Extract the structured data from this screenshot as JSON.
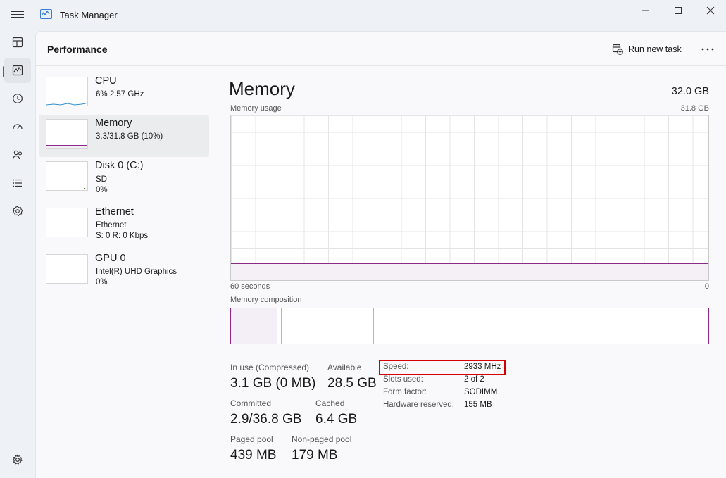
{
  "window": {
    "title": "Task Manager",
    "accent": "#1f6fd1",
    "memory_color": "#8b2a8a"
  },
  "rail": {
    "items": [
      {
        "icon": "processes-icon"
      },
      {
        "icon": "performance-icon"
      },
      {
        "icon": "app-history-icon"
      },
      {
        "icon": "startup-apps-icon"
      },
      {
        "icon": "users-icon"
      },
      {
        "icon": "details-icon"
      },
      {
        "icon": "services-icon"
      }
    ],
    "settings_icon": "settings-icon"
  },
  "header": {
    "page_title": "Performance",
    "run_new_task": "Run new task",
    "more_icon": "more-options-icon"
  },
  "resources": [
    {
      "name": "CPU",
      "line1": "6%  2.57 GHz",
      "line2": ""
    },
    {
      "name": "Memory",
      "line1": "3.3/31.8 GB (10%)",
      "line2": ""
    },
    {
      "name": "Disk 0 (C:)",
      "line1": "SD",
      "line2": "0%"
    },
    {
      "name": "Ethernet",
      "line1": "Ethernet",
      "line2": "S: 0 R: 0 Kbps"
    },
    {
      "name": "GPU 0",
      "line1": "Intel(R) UHD Graphics",
      "line2": "0%"
    }
  ],
  "detail": {
    "title": "Memory",
    "total": "32.0 GB",
    "usage_label": "Memory usage",
    "usage_max": "31.8 GB",
    "time_label": "60 seconds",
    "time_end": "0",
    "usage_fraction": 0.104,
    "composition_label": "Memory composition",
    "composition": {
      "in_use_fraction": 0.097,
      "modified_fraction": 0.009,
      "standby_fraction": 0.193
    },
    "stats": {
      "in_use_label": "In use (Compressed)",
      "in_use_value": "3.1 GB (0 MB)",
      "available_label": "Available",
      "available_value": "28.5 GB",
      "committed_label": "Committed",
      "committed_value": "2.9/36.8 GB",
      "cached_label": "Cached",
      "cached_value": "6.4 GB",
      "paged_label": "Paged pool",
      "paged_value": "439 MB",
      "nonpaged_label": "Non-paged pool",
      "nonpaged_value": "179 MB"
    },
    "properties": [
      {
        "key": "Speed:",
        "value": "2933 MHz"
      },
      {
        "key": "Slots used:",
        "value": "2 of 2"
      },
      {
        "key": "Form factor:",
        "value": "SODIMM"
      },
      {
        "key": "Hardware reserved:",
        "value": "155 MB"
      }
    ]
  }
}
